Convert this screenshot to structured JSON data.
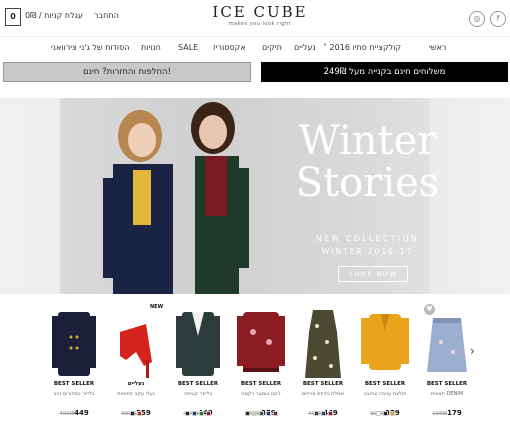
{
  "header": {
    "cart_count": "0",
    "cart_label": "עגלת קניות / 0₪",
    "login_label": "התחבר",
    "logo": "ICE CUBE",
    "logo_tagline": "makes you look right",
    "social": [
      {
        "icon": "facebook-icon",
        "glyph": "f"
      },
      {
        "icon": "instagram-icon",
        "glyph": "◎"
      }
    ]
  },
  "nav": {
    "items": [
      {
        "label": "ראשי"
      },
      {
        "label": "˅ קולקציית סתיו 2016"
      },
      {
        "label": "נעליים"
      },
      {
        "label": "תיקים"
      },
      {
        "label": "אקססוריז"
      },
      {
        "label": "SALE"
      },
      {
        "label": "חנויות"
      },
      {
        "label": "הסודות של ג'ני צירוואני"
      }
    ]
  },
  "promo": {
    "shipping": "משלוחים חינם בקנייה מעל 249₪",
    "returns": "החלפות והחזרות? חינם!"
  },
  "hero": {
    "title_line1": "Winter",
    "title_line2": "Stories",
    "subtitle1": "NEW COLLECTION",
    "subtitle2": "WINTER 2016-17",
    "cta": "SHOP NOW"
  },
  "carousel": {
    "prev_arrow": "‹",
    "next_arrow": "›",
    "new_badge": "NEW",
    "products": [
      {
        "tag": "BEST SELLER",
        "name": "בלייזר כפתורים זהב",
        "old_price": "499₪",
        "price": "449",
        "swatches": [],
        "img": "navy-blazer"
      },
      {
        "tag": "נעליים",
        "name": "נעלי עקב פתוחות",
        "old_price": "399₪",
        "price": "359",
        "swatches": [
          "#222222",
          "#c4331f"
        ],
        "img": "red-heels"
      },
      {
        "tag": "BEST SELLER",
        "name": "בלייזר קטיפה",
        "old_price": "499₪",
        "price": "449",
        "swatches": [
          "#222222",
          "#1e3d7a",
          "#2f7d3c",
          "#8a1c22"
        ],
        "img": "velvet-blazer"
      },
      {
        "tag": "BEST SELLER",
        "name": "ז'קט בומבר רקמה",
        "old_price": "399₪",
        "price": "359",
        "swatches": [
          "#222222",
          "#d8c7a5",
          "#1f6b3f",
          "#1e3d7a",
          "#8a1c22"
        ],
        "img": "bomber-jacket"
      },
      {
        "tag": "BEST SELLER",
        "name": "שמלת הדפס פרחים",
        "old_price": "499₪",
        "price": "449",
        "swatches": [
          "#3e3e2c",
          "#1e3d7a",
          "#8a1c22"
        ],
        "img": "floral-dress"
      },
      {
        "tag": "BEST SELLER",
        "name": "חולצת עניבה צהובה",
        "old_price": "399₪",
        "price": "359",
        "swatches": [
          "#ffffff",
          "#222222",
          "#e8a51c"
        ],
        "img": "yellow-blouse"
      },
      {
        "tag": "BEST SELLER",
        "name": "חצאית DENIM",
        "old_price": "199₪",
        "price": "179",
        "swatches": [],
        "img": "denim-skirt"
      }
    ]
  }
}
